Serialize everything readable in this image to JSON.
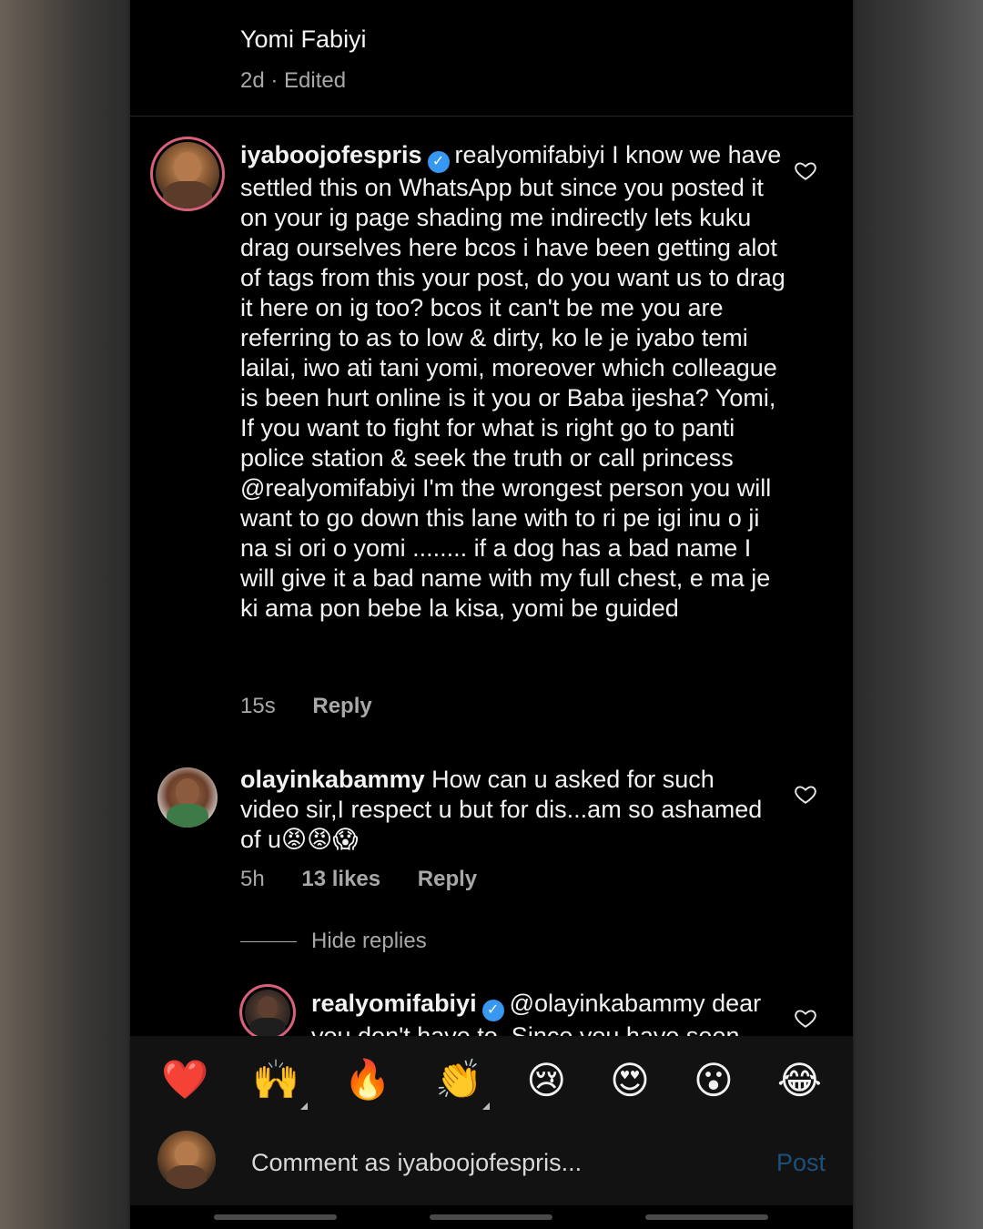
{
  "post": {
    "author": "Yomi Fabiyi",
    "meta": "2d · Edited"
  },
  "comments": [
    {
      "username": "iyaboojofespris",
      "text": "realyomifabiyi I know we have settled this on WhatsApp but since you posted it on your ig page shading me indirectly lets kuku drag ourselves here bcos i have been getting alot of tags from this your post, do you want us to drag it here on ig too? bcos it can't be me you are referring to as to low & dirty, ko le je iyabo temi lailai, iwo ati tani yomi, moreover which colleague is been hurt online is it you or Baba ijesha? Yomi, If you want to fight for what is right go to panti police station & seek the truth or call princess @realyomifabiyi I'm the wrongest person you will want to go down this lane with to ri pe igi inu o ji na si ori o yomi  ........ if a dog has a bad  name I will give it a bad name with my full chest, e ma je ki ama pon bebe la kisa, yomi be guided",
      "time": "15s",
      "reply": "Reply"
    },
    {
      "username": "olayinkabammy",
      "text": "How can u asked for such video sir,I respect u but for dis...am so ashamed of u😡😡😱",
      "time": "5h",
      "likes": "13 likes",
      "reply": "Reply"
    }
  ],
  "hide_replies": "Hide replies",
  "reply_comment": {
    "username": "realyomifabiyi",
    "text": "@olayinkabammy dear you don't have to. Since you have seen"
  },
  "reactions": [
    "❤️",
    "🙌",
    "🔥",
    "👏",
    "😢",
    "😍",
    "😮",
    "😂"
  ],
  "composer": {
    "placeholder": "Comment as iyaboojofespris...",
    "post_label": "Post"
  }
}
